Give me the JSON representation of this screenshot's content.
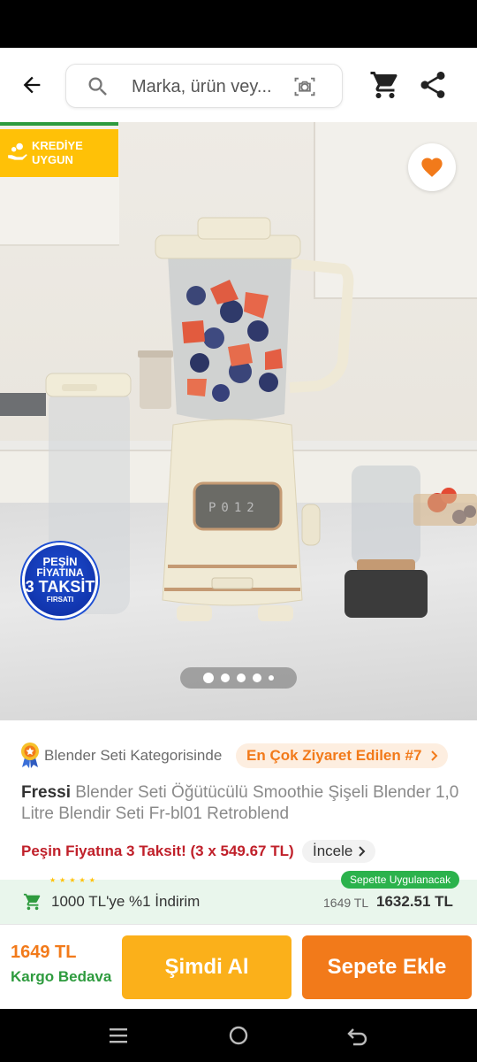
{
  "search": {
    "placeholder": "Marka, ürün vey..."
  },
  "badges": {
    "kredi": "KREDİYE UYGUN",
    "taksit_line1": "PEŞİN",
    "taksit_line2": "FİYATINA",
    "taksit_line3": "3 TAKSİT",
    "taksit_line4": "FIRSATI"
  },
  "carousel": {
    "page_count": 5,
    "active_index": 0
  },
  "category": {
    "label": "Blender Seti Kategorisinde",
    "rank_label": "En Çok Ziyaret Edilen #7"
  },
  "product": {
    "brand": "Fressi",
    "name": "Blender Seti Öğütücülü Smoothie Şişeli Blender 1,0 Litre Blendir Seti Fr-bl01 Retroblend"
  },
  "promo": {
    "text": "Peşin Fiyatına 3 Taksit! (3 x 549.67 TL)",
    "link_label": "İncele"
  },
  "discount": {
    "label": "1000 TL'ye %1 İndirim",
    "badge": "Sepette Uygulanacak",
    "old_price": "1649 TL",
    "new_price": "1632.51 TL"
  },
  "footer": {
    "price": "1649 TL",
    "shipping": "Kargo Bedava",
    "buy_label": "Şimdi Al",
    "cart_label": "Sepete Ekle"
  },
  "icons": {
    "back": "arrow-left-icon",
    "search": "search-icon",
    "camera": "camera-search-icon",
    "cart": "cart-icon",
    "share": "share-icon",
    "favorite": "heart-icon"
  },
  "colors": {
    "brand_orange": "#f27a1a",
    "buy_yellow": "#fbb01a",
    "promo_red": "#c0202a",
    "green": "#2e9b3e",
    "badge_yellow": "#ffc107"
  }
}
